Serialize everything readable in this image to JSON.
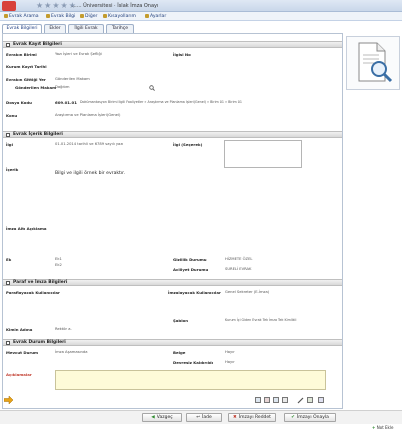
{
  "window": {
    "title": "...... Üniversitesi · İslak İmza Onayı",
    "stars": "★★★★★"
  },
  "menu": [
    {
      "label": "Evrak Arama",
      "icon": "search-icon"
    },
    {
      "label": "Evrak Bilgi",
      "icon": "info-icon"
    },
    {
      "label": "Diğer",
      "icon": "folder-icon"
    },
    {
      "label": "Kısayollarım",
      "icon": "shortcut-icon"
    },
    {
      "label": "Ayarlar",
      "icon": "gear-icon"
    }
  ],
  "tabs": [
    "Evrak Bilgileri",
    "Ekler",
    "İlgili Evrak",
    "Tarihçe"
  ],
  "sections": {
    "kayit": "Evrak Kayıt Bilgileri",
    "icerik": "Evrak İçerik Bilgileri",
    "paraf": "Paraf ve İmza Bilgileri",
    "durum": "Evrak Durum Bilgileri"
  },
  "kayit": {
    "evrak_birimi_label": "Evrakın Birimi",
    "evrak_birimi_value": "Yazı İşleri ve Evrak Şefliği",
    "ilgisi_no_label": "İlgisi No",
    "kurum_kayit_label": "Kurum Kayıt Tarihi",
    "gittigi_yer_label": "Evrakın Gittiği Yer",
    "gittigi_yer_value": "Gönderilen Makam",
    "gonderilen_makam_label": "Gönderilen Makam",
    "gonderilen_makam_value": "Dağıtım",
    "dosya_kodu_label": "Dosya Kodu",
    "dosya_kodu_value": "609.01.01",
    "dosya_kodu_desc": "Dokümantasyon Birimi İlgili Faaliyetler » Araştırma ve Planlama İşleri(Genel) » Birim 01 » Birim 01",
    "konu_label": "Konu",
    "konu_value": "Araştırma ve Planlama İşleri(Genel)"
  },
  "icerik": {
    "ilgi_label": "İlgi",
    "ilgi_value": "01.01.2014 tarihli ve 6789 sayılı yazı",
    "ilgi_seperek_label": "İlgi (Seçerek)",
    "icerik_label": "İçerik",
    "icerik_value": "Bilgi ve ilgili örnek bir evraktır.",
    "imza_alti_label": "İmza Altı Açıklama",
    "ek_label": "Ek",
    "ek_value_1": "Ek1",
    "ek_value_2": "Ek2",
    "gizlilik_label": "Gizlilik Durumu",
    "gizlilik_value": "HİZMETE ÖZEL",
    "aciliyet_label": "Aciliyet Durumu",
    "aciliyet_value": "SURELİ EVRAK"
  },
  "paraf": {
    "paraflayacak_label": "Paraflayacak Kullanıcılar",
    "imzalayacak_label": "İmzalayacak Kullanıcılar",
    "imzalayacak_value": "Genel Sekreter (E-İmza)",
    "sablon_label": "Şablon",
    "sablon_value": "Kurum İçi Giden Evrak Tek İmza Tek Kimlikli",
    "kimin_adina_label": "Kimin Adına",
    "kimin_adina_value": "Rektör a."
  },
  "durum": {
    "mevcut_label": "Mevcut Durum",
    "mevcut_value": "İmza Aşamasında",
    "belge_label": "Belge",
    "belge_value": "Hayır",
    "devresiz_label": "Devresiz Kaldırıldı",
    "devresiz_value": "Hayır",
    "aciklama_label": "Açıklamalar"
  },
  "buttons": {
    "vazgec": "Vazgeç",
    "iade": "İade",
    "imzayi_reddet": "İmzayı Reddet",
    "imzayi_onayla": "İmzayı Onayla"
  },
  "footer": {
    "not_ekle": "Not Ekle"
  },
  "colors": {
    "section_bg": "#d9d9d9",
    "link": "#1d3c7a",
    "note_bg": "#fefbd8",
    "approve": "#2e8b2e",
    "reject": "#c0392b"
  }
}
